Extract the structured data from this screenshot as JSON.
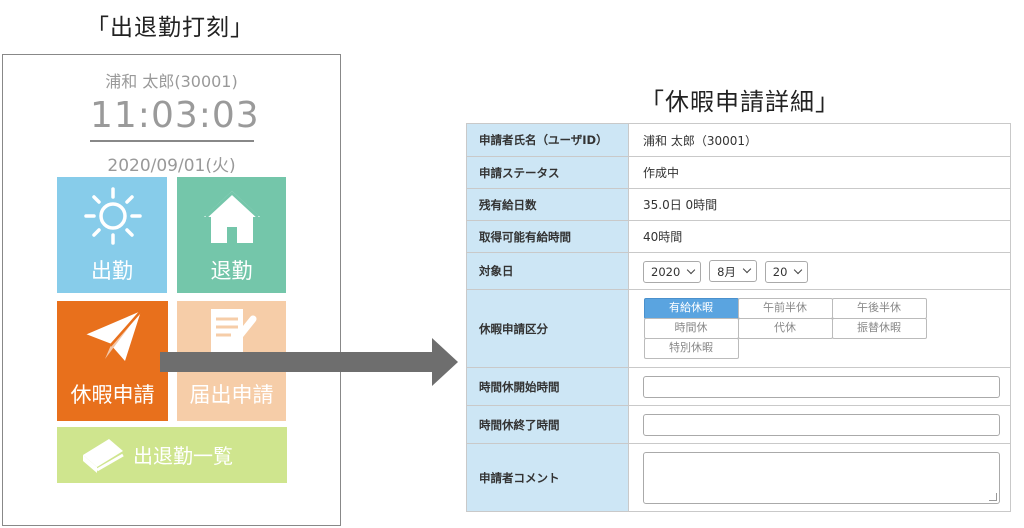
{
  "titles": {
    "left": "「出退勤打刻」",
    "right": "「休暇申請詳細」"
  },
  "punch": {
    "user": "浦和 太郎(30001)",
    "clock": "11:03:03",
    "date": "2020/09/01(火)",
    "tiles": {
      "clock_in": "出勤",
      "clock_out": "退勤",
      "leave_request": "休暇申請",
      "notification": "届出申請",
      "attendance_list": "出退勤一覧"
    },
    "icons": {
      "clock_in": "sun-icon",
      "clock_out": "home-icon",
      "leave_request": "paper-plane-icon",
      "notification": "document-pen-icon",
      "attendance_list": "book-icon"
    },
    "colors": {
      "clock_in": "#87ccea",
      "clock_out": "#74c6aa",
      "leave_request": "#e8701c",
      "notification": "#f6cda8",
      "attendance_list": "#cfe58e"
    }
  },
  "form": {
    "rows": {
      "applicant_label": "申請者氏名（ユーザID）",
      "applicant_value": "浦和 太郎（30001）",
      "status_label": "申請ステータス",
      "status_value": "作成中",
      "remaining_label": "残有給日数",
      "remaining_value": "35.0日 0時間",
      "available_hours_label": "取得可能有給時間",
      "available_hours_value": "40時間",
      "target_date_label": "対象日",
      "leave_type_label": "休暇申請区分",
      "start_time_label": "時間休開始時間",
      "end_time_label": "時間休終了時間",
      "comment_label": "申請者コメント"
    },
    "target_date": {
      "year": "2020",
      "month": "8月",
      "day": "20"
    },
    "leave_types": [
      "有給休暇",
      "午前半休",
      "午後半休",
      "時間休",
      "代休",
      "振替休暇",
      "特別休暇"
    ],
    "selected_leave_type": "有給休暇",
    "header_color": "#cde6f5"
  }
}
